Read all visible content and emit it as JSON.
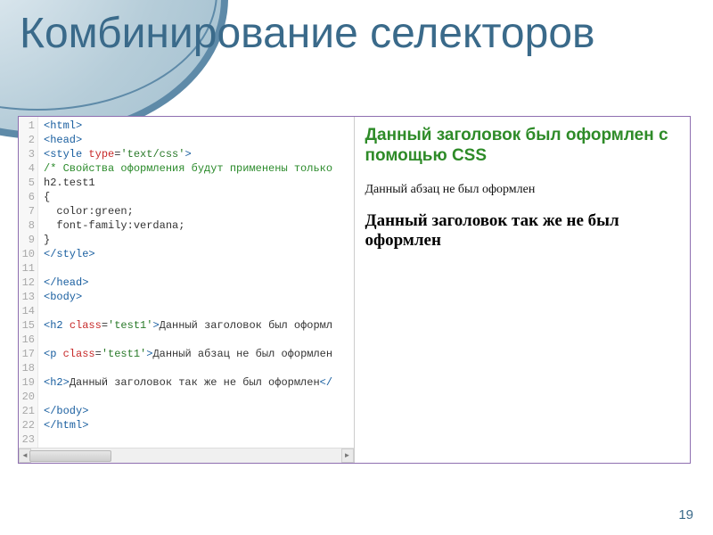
{
  "slide": {
    "title": "Комбинирование селекторов",
    "page_number": "19"
  },
  "code": {
    "lines": [
      {
        "n": "1",
        "html": "<span class='tok-tag'>&lt;html&gt;</span>"
      },
      {
        "n": "2",
        "html": "<span class='tok-tag'>&lt;head&gt;</span>"
      },
      {
        "n": "3",
        "html": "<span class='tok-tag'>&lt;style</span> <span class='tok-attr'>type</span>=<span class='tok-val'>'text/css'</span><span class='tok-tag'>&gt;</span>"
      },
      {
        "n": "4",
        "html": "<span class='tok-comment'>/* Свойства оформления будут применены только</span>"
      },
      {
        "n": "5",
        "html": "<span class='tok-plain'>h2.test1</span>"
      },
      {
        "n": "6",
        "html": "<span class='tok-plain'>{</span>"
      },
      {
        "n": "7",
        "html": "<span class='tok-plain'>&nbsp;&nbsp;color:green;</span>"
      },
      {
        "n": "8",
        "html": "<span class='tok-plain'>&nbsp;&nbsp;font-family:verdana;</span>"
      },
      {
        "n": "9",
        "html": "<span class='tok-plain'>}</span>"
      },
      {
        "n": "10",
        "html": "<span class='tok-tag'>&lt;/style&gt;</span>"
      },
      {
        "n": "11",
        "html": ""
      },
      {
        "n": "12",
        "html": "<span class='tok-tag'>&lt;/head&gt;</span>"
      },
      {
        "n": "13",
        "html": "<span class='tok-tag'>&lt;body&gt;</span>"
      },
      {
        "n": "14",
        "html": ""
      },
      {
        "n": "15",
        "html": "<span class='tok-tag'>&lt;h2</span> <span class='tok-attr'>class</span>=<span class='tok-val'>'test1'</span><span class='tok-tag'>&gt;</span>Данный заголовок был оформл"
      },
      {
        "n": "16",
        "html": ""
      },
      {
        "n": "17",
        "html": "<span class='tok-tag'>&lt;p</span> <span class='tok-attr'>class</span>=<span class='tok-val'>'test1'</span><span class='tok-tag'>&gt;</span>Данный абзац не был оформлен"
      },
      {
        "n": "18",
        "html": ""
      },
      {
        "n": "19",
        "html": "<span class='tok-tag'>&lt;h2&gt;</span>Данный заголовок так же не был оформлен<span class='tok-tag'>&lt;/</span>"
      },
      {
        "n": "20",
        "html": ""
      },
      {
        "n": "21",
        "html": "<span class='tok-tag'>&lt;/body&gt;</span>"
      },
      {
        "n": "22",
        "html": "<span class='tok-tag'>&lt;/html&gt;</span>"
      },
      {
        "n": "23",
        "html": ""
      }
    ]
  },
  "preview": {
    "styled_h2": "Данный заголовок был оформлен с помощью CSS",
    "paragraph": "Данный абзац не был оформлен",
    "plain_h2": "Данный заголовок так же не был оформлен"
  },
  "scrollbar": {
    "left_glyph": "◄",
    "right_glyph": "►"
  }
}
